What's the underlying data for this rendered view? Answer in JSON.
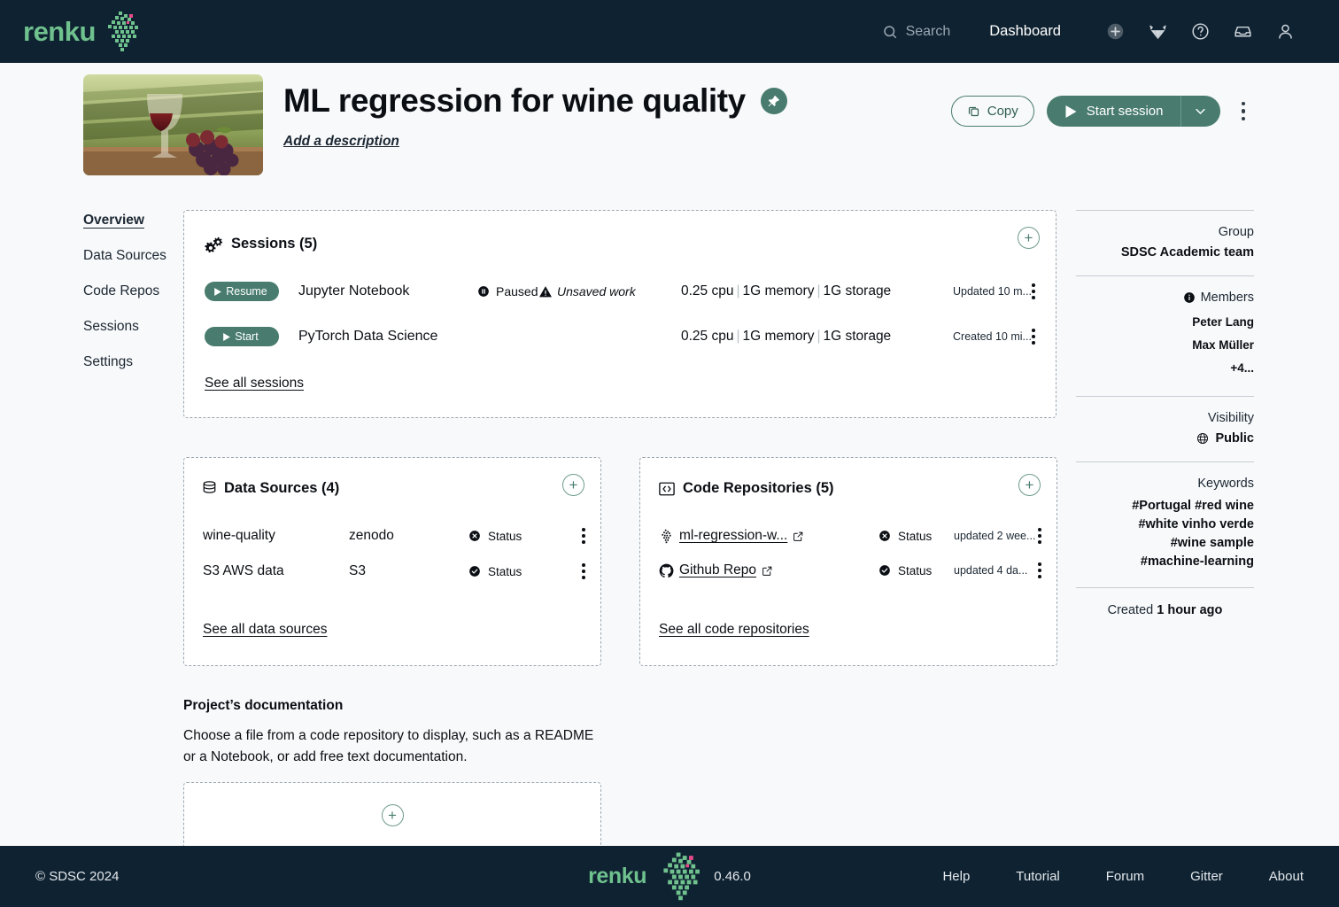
{
  "topnav": {
    "logo_text": "renku",
    "search_label": "Search",
    "dashboard_label": "Dashboard",
    "icons": [
      "plus-circle-icon",
      "gitlab-icon",
      "help-circle-icon",
      "inbox-icon",
      "user-icon"
    ]
  },
  "project": {
    "title": "ML regression for wine quality",
    "pin_icon": "pin-icon",
    "description_placeholder": "Add a description",
    "copy_label": "Copy",
    "start_session_label": "Start session"
  },
  "leftnav": {
    "items": [
      {
        "label": "Overview",
        "active": true
      },
      {
        "label": "Data Sources",
        "active": false
      },
      {
        "label": "Code Repos",
        "active": false
      },
      {
        "label": "Sessions",
        "active": false
      },
      {
        "label": "Settings",
        "active": false
      }
    ]
  },
  "sessions": {
    "title": "Sessions (5)",
    "see_all": "See all sessions",
    "rows": [
      {
        "action": "Resume",
        "name": "Jupyter Notebook",
        "state": "Paused",
        "warning": "Unsaved work",
        "cpu": "0.25 cpu",
        "memory": "1G memory",
        "storage": "1G storage",
        "time": "Updated 10 m..."
      },
      {
        "action": "Start",
        "name": "PyTorch Data Science",
        "state": "",
        "warning": "",
        "cpu": "0.25 cpu",
        "memory": "1G memory",
        "storage": "1G storage",
        "time": "Created 10 mi..."
      }
    ]
  },
  "data_sources": {
    "title": "Data Sources (4)",
    "see_all": "See all data sources",
    "rows": [
      {
        "name": "wine-quality",
        "kind": "zenodo",
        "status": "Status",
        "status_icon": "error-circle-icon"
      },
      {
        "name": "S3 AWS data",
        "kind": "S3",
        "status": "Status",
        "status_icon": "check-circle-icon"
      }
    ]
  },
  "code_repos": {
    "title": "Code Repositories (5)",
    "see_all": "See all code repositories",
    "rows": [
      {
        "name": "ml-regression-w...",
        "icon": "renku-icon",
        "status": "Status",
        "status_icon": "error-circle-icon",
        "time": "updated 2 wee..."
      },
      {
        "name": "Github Repo",
        "icon": "github-icon",
        "status": "Status",
        "status_icon": "check-circle-icon",
        "time": "updated 4 da..."
      }
    ]
  },
  "documentation": {
    "title": "Project’s documentation",
    "text": "Choose a file from a code repository to display, such as a README or a Notebook, or add free text documentation."
  },
  "sidebar": {
    "group_label": "Group",
    "group_value": "SDSC Academic team",
    "members_label": "Members",
    "members": [
      "Peter Lang",
      "Max Müller",
      "+4..."
    ],
    "visibility_label": "Visibility",
    "visibility_value": "Public",
    "keywords_label": "Keywords",
    "keywords_lines": [
      "#Portugal #red wine",
      "#white vinho verde",
      "#wine sample",
      "#machine-learning"
    ],
    "created_label": "Created",
    "created_value": "1 hour ago"
  },
  "footer": {
    "copyright": "© SDSC 2024",
    "logo_text": "renku",
    "version": "0.46.0",
    "links": [
      "Help",
      "Tutorial",
      "Forum",
      "Gitter",
      "About"
    ]
  },
  "colors": {
    "navy": "#0f2231",
    "green": "#497c6f",
    "logo_green": "#6fc18e",
    "page_bg": "#f8f9fa"
  }
}
